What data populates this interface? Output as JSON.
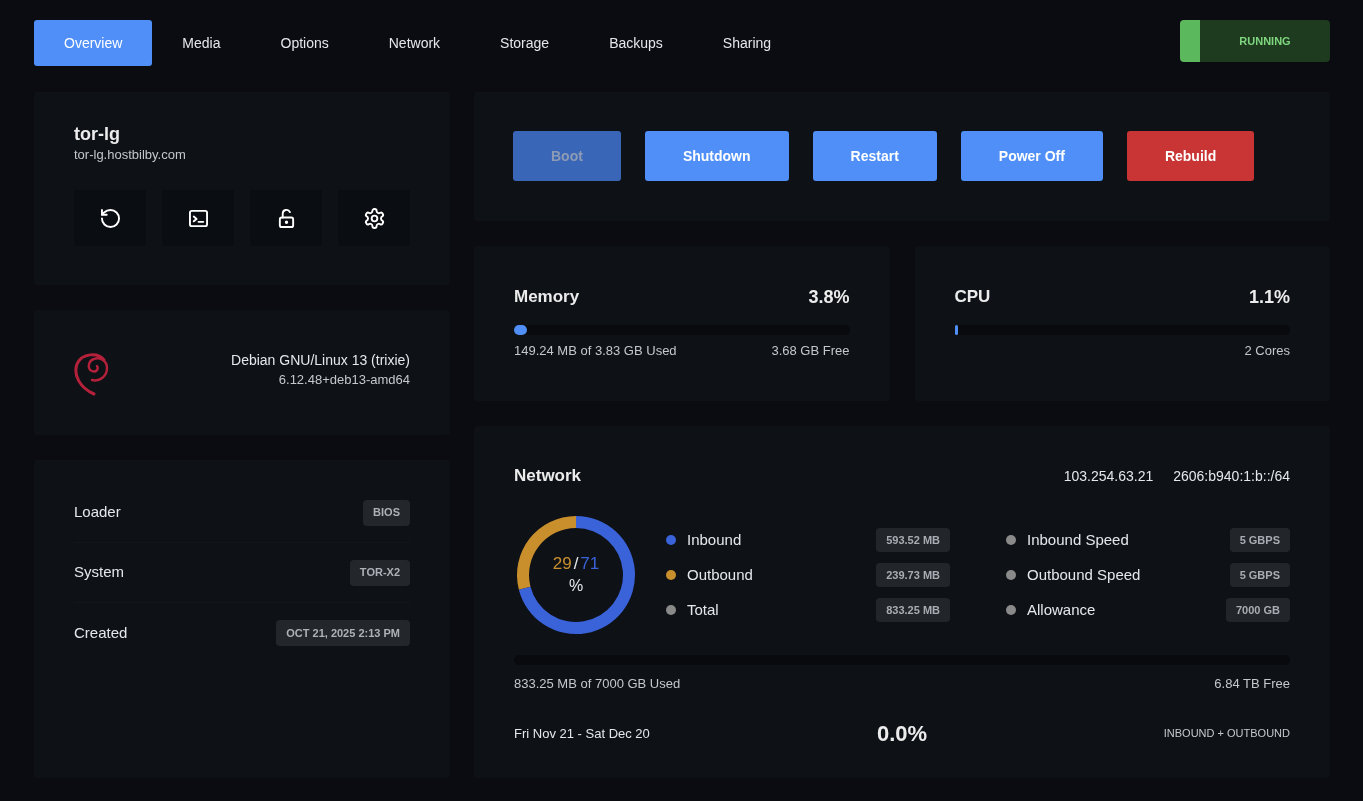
{
  "tabs": [
    {
      "label": "Overview",
      "selected": true
    },
    {
      "label": "Media",
      "selected": false
    },
    {
      "label": "Options",
      "selected": false
    },
    {
      "label": "Network",
      "selected": false
    },
    {
      "label": "Storage",
      "selected": false
    },
    {
      "label": "Backups",
      "selected": false
    },
    {
      "label": "Sharing",
      "selected": false
    }
  ],
  "status": {
    "label": "RUNNING"
  },
  "server": {
    "name": "tor-lg",
    "hostname": "tor-lg.hostbilby.com"
  },
  "os": {
    "name": "Debian GNU/Linux 13 (trixie)",
    "kernel": "6.12.48+deb13-amd64"
  },
  "details": [
    {
      "label": "Loader",
      "value": "BIOS"
    },
    {
      "label": "System",
      "value": "TOR-X2"
    },
    {
      "label": "Created",
      "value": "OCT 21, 2025 2:13 PM"
    }
  ],
  "actions": [
    {
      "label": "Boot",
      "kind": "primary",
      "disabled": true
    },
    {
      "label": "Shutdown",
      "kind": "primary",
      "disabled": false
    },
    {
      "label": "Restart",
      "kind": "primary",
      "disabled": false
    },
    {
      "label": "Power Off",
      "kind": "primary",
      "disabled": false
    },
    {
      "label": "Rebuild",
      "kind": "danger",
      "disabled": false
    }
  ],
  "meters": [
    {
      "title": "Memory",
      "reading": "3.8%",
      "level": 0.038,
      "note_left": "149.24 MB of 3.83 GB Used",
      "note_right": "3.68 GB Free"
    },
    {
      "title": "CPU",
      "reading": "1.1%",
      "level": 0.011,
      "note_right": "2 Cores"
    }
  ],
  "network": {
    "title": "Network",
    "addresses": [
      "103.254.63.21",
      "2606:b940:1:b::/64"
    ],
    "chart_data": {
      "type": "donut",
      "values": [
        29,
        71
      ],
      "colors": [
        "#c98f2c",
        "#3a62d9"
      ]
    },
    "center": {
      "first": "29",
      "separator": "/",
      "second": "71",
      "unit": "%"
    },
    "traffic": [
      {
        "label": "Inbound",
        "value": "593.52 MB",
        "color": "#3a62d9"
      },
      {
        "label": "Outbound",
        "value": "239.73 MB",
        "color": "#c98f2c"
      },
      {
        "label": "Total",
        "value": "833.25 MB",
        "color": "#8a8a8a"
      }
    ],
    "limits": [
      {
        "label": "Inbound Speed",
        "value": "5 GBPS",
        "color": "#8a8a8a"
      },
      {
        "label": "Outbound Speed",
        "value": "5 GBPS",
        "color": "#8a8a8a"
      },
      {
        "label": "Allowance",
        "value": "7000 GB",
        "color": "#8a8a8a"
      }
    ],
    "allowance": {
      "used": "833.25 MB of 7000 GB Used",
      "free": "6.84 TB Free"
    },
    "period": "Fri Nov 21 - Sat Dec 20",
    "usage": "0.0%",
    "scope": "INBOUND + OUTBOUND"
  }
}
